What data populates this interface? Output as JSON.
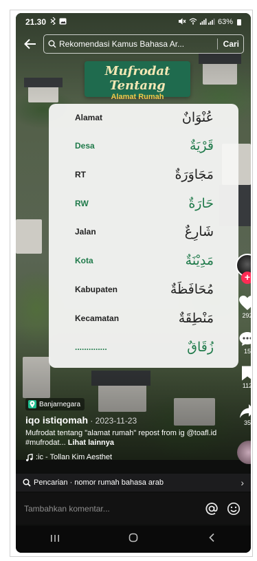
{
  "status_bar": {
    "time": "21.30",
    "battery": "63%"
  },
  "search": {
    "query": "Rekomendasi Kamus Bahasa Ar...",
    "button_label": "Cari"
  },
  "banner": {
    "title": "Mufrodat Tentang",
    "subtitle": "Alamat Rumah"
  },
  "vocab": [
    {
      "id": "Alamat",
      "ar": "عُنْوَانٌ",
      "color": "dark"
    },
    {
      "id": "Desa",
      "ar": "قَرْيَةٌ",
      "color": "green"
    },
    {
      "id": "RT",
      "ar": "مَجَاوَرَةٌ",
      "color": "dark"
    },
    {
      "id": "RW",
      "ar": "حَارَةٌ",
      "color": "green"
    },
    {
      "id": "Jalan",
      "ar": "شَارِعٌ",
      "color": "dark"
    },
    {
      "id": "Kota",
      "ar": "مَدِيْنَةٌ",
      "color": "green"
    },
    {
      "id": "Kabupaten",
      "ar": "مُحَافَظَةٌ",
      "color": "dark"
    },
    {
      "id": "Kecamatan",
      "ar": "مَنْطِقَةٌ",
      "color": "dark"
    },
    {
      "id": "..............",
      "ar": "زُقَاقٌ",
      "color": "green"
    }
  ],
  "rail": {
    "likes": "292",
    "comments": "15",
    "bookmarks": "112",
    "shares": "35"
  },
  "post": {
    "location": "Banjarnegara",
    "author": "iqo istiqomah",
    "date": " · 2023-11-23",
    "caption": "Mufrodat tentang \"alamat rumah\" repost from ig @toafl.id #mufrodat...",
    "more": "Lihat lainnya",
    "music": ":ic - Tollan Kim   Aesthet"
  },
  "suggestion": {
    "text": "Pencarian · nomor rumah bahasa arab"
  },
  "comment": {
    "placeholder": "Tambahkan komentar..."
  },
  "colors": {
    "banner_green": "#1f6b4e",
    "vocab_green": "#1f7a4a",
    "follow_red": "#fe2c55"
  }
}
